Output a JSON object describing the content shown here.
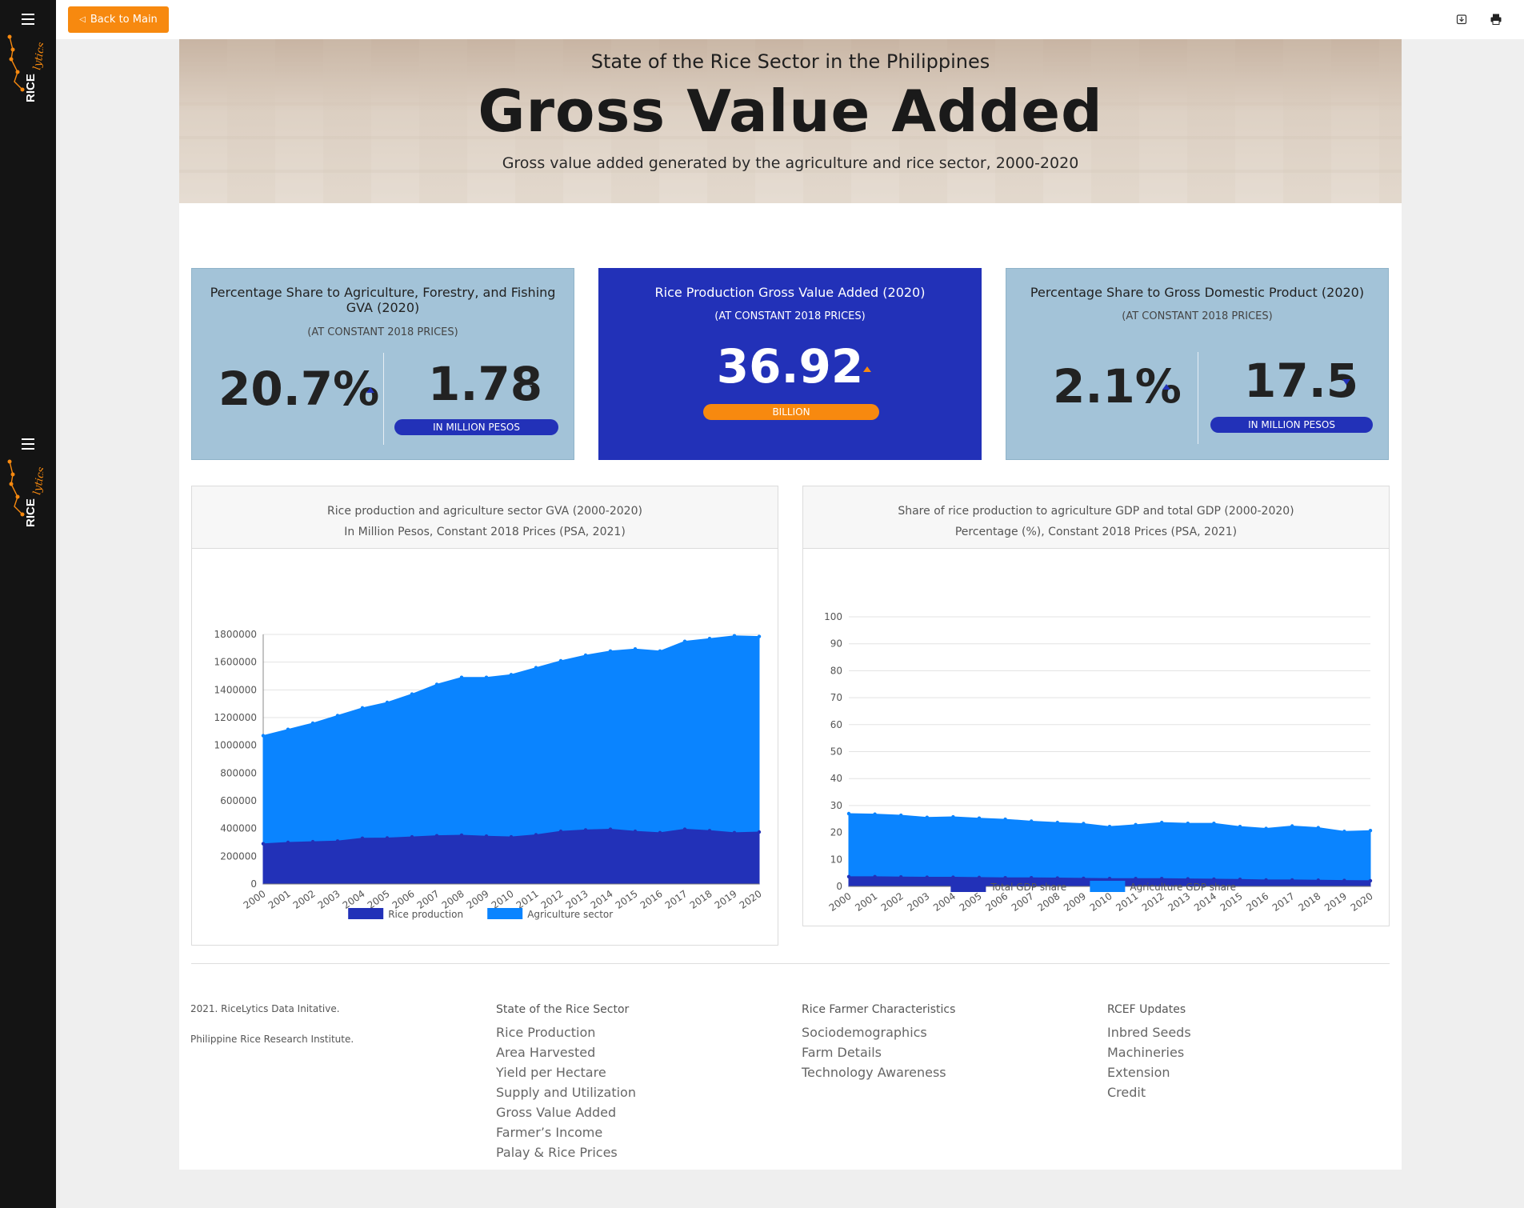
{
  "sidebar": {
    "menu_icon": "hamburger-icon",
    "logo_text": "RICE",
    "logo_script": "lytics"
  },
  "topbar": {
    "back_label": "Back to Main",
    "download_icon": "download-icon",
    "print_icon": "print-icon"
  },
  "hero": {
    "supertitle": "State of the Rice Sector in the Philippines",
    "title": "Gross Value Added",
    "subtitle": "Gross value added generated by the agriculture and rice sector, 2000-2020"
  },
  "stats": {
    "card1": {
      "title": "Percentage Share to Agriculture, Forestry, and Fishing GVA (2020)",
      "note": "(AT CONSTANT 2018 PRICES)",
      "value1": "20.7%",
      "value2": "1.78",
      "unit2": "IN MILLION PESOS"
    },
    "card2": {
      "title": "Rice Production Gross Value Added (2020)",
      "note": "(AT CONSTANT 2018 PRICES)",
      "value": "36.92",
      "unit": "BILLION"
    },
    "card3": {
      "title": "Percentage Share to Gross Domestic Product (2020)",
      "note": "(AT CONSTANT 2018 PRICES)",
      "value1": "2.1%",
      "value2": "17.5",
      "unit2": "IN MILLION PESOS"
    }
  },
  "colors": {
    "orange": "#f7890f",
    "dark_blue": "#2231b8",
    "bright_blue": "#0a84ff",
    "light_card": "#a3c3d8",
    "sidebar": "#141414"
  },
  "chart_data": [
    {
      "type": "area",
      "title": "Rice production and agriculture sector GVA (2000-2020)",
      "subtitle": "In Million Pesos, Constant 2018 Prices (PSA, 2021)",
      "x": [
        "2000",
        "2001",
        "2002",
        "2003",
        "2004",
        "2005",
        "2006",
        "2007",
        "2008",
        "2009",
        "2010",
        "2011",
        "2012",
        "2013",
        "2014",
        "2015",
        "2016",
        "2017",
        "2018",
        "2019",
        "2020"
      ],
      "ylim": [
        0,
        1800000
      ],
      "yticks": [
        0,
        200000,
        400000,
        600000,
        800000,
        1000000,
        1200000,
        1400000,
        1600000,
        1800000
      ],
      "legend": "bottom",
      "series": [
        {
          "name": "Rice production",
          "color": "#2231b8",
          "values": [
            290000,
            300000,
            305000,
            310000,
            330000,
            332000,
            340000,
            348000,
            352000,
            345000,
            340000,
            355000,
            380000,
            390000,
            395000,
            380000,
            370000,
            395000,
            385000,
            370000,
            375000
          ]
        },
        {
          "name": "Agriculture sector",
          "color": "#0a84ff",
          "values": [
            1070000,
            1115000,
            1160000,
            1215000,
            1270000,
            1310000,
            1370000,
            1440000,
            1490000,
            1490000,
            1510000,
            1560000,
            1610000,
            1650000,
            1680000,
            1695000,
            1680000,
            1750000,
            1770000,
            1790000,
            1785000
          ]
        }
      ]
    },
    {
      "type": "area",
      "title": "Share of rice production to agriculture GDP and total GDP (2000-2020)",
      "subtitle": "Percentage (%), Constant 2018 Prices (PSA, 2021)",
      "x": [
        "2000",
        "2001",
        "2002",
        "2003",
        "2004",
        "2005",
        "2006",
        "2007",
        "2008",
        "2009",
        "2010",
        "2011",
        "2012",
        "2013",
        "2014",
        "2015",
        "2016",
        "2017",
        "2018",
        "2019",
        "2020"
      ],
      "ylim": [
        0,
        100
      ],
      "yticks": [
        0,
        10,
        20,
        30,
        40,
        50,
        60,
        70,
        80,
        90,
        100
      ],
      "legend": "bottom",
      "series": [
        {
          "name": "Total GDP share",
          "color": "#2231b8",
          "values": [
            3.6,
            3.6,
            3.5,
            3.4,
            3.4,
            3.3,
            3.2,
            3.2,
            3.1,
            3.0,
            2.9,
            2.9,
            2.9,
            2.8,
            2.7,
            2.6,
            2.4,
            2.4,
            2.3,
            2.2,
            2.1
          ]
        },
        {
          "name": "Agriculture GDP share",
          "color": "#0a84ff",
          "values": [
            27,
            26.8,
            26.4,
            25.6,
            25.8,
            25.3,
            24.9,
            24.2,
            23.7,
            23.3,
            22.2,
            22.9,
            23.7,
            23.4,
            23.4,
            22.2,
            21.5,
            22.4,
            21.8,
            20.4,
            20.7
          ]
        }
      ]
    }
  ],
  "footer": {
    "copyright": "2021. RiceLytics Data Initative.",
    "org": "Philippine Rice Research Institute.",
    "col1": {
      "heading": "State of the Rice Sector",
      "links": [
        "Rice Production",
        "Area Harvested",
        "Yield per Hectare",
        "Supply and Utilization",
        "Gross Value Added",
        "Farmer’s Income",
        "Palay & Rice Prices"
      ]
    },
    "col2": {
      "heading": "Rice Farmer Characteristics",
      "links": [
        "Sociodemographics",
        "Farm Details",
        "Technology Awareness"
      ]
    },
    "col3": {
      "heading": "RCEF Updates",
      "links": [
        "Inbred Seeds",
        "Machineries",
        "Extension",
        "Credit"
      ]
    }
  }
}
